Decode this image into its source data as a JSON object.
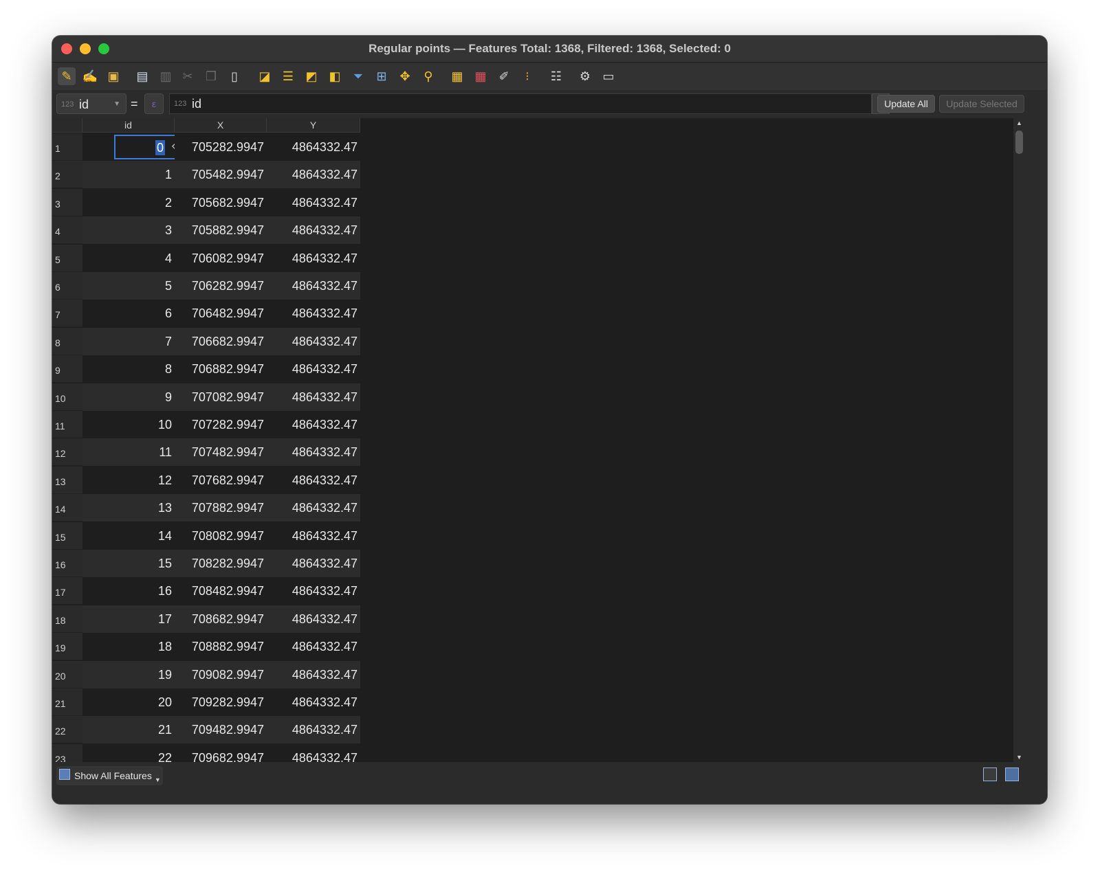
{
  "window": {
    "title": "Regular points — Features Total: 1368, Filtered: 1368, Selected: 0"
  },
  "toolbar": {
    "icons": [
      "toggle-editing-icon",
      "toggle-multi-edit-icon",
      "save-edits-icon",
      "reload-table-icon",
      "delete-selected-icon",
      "cut-selected-icon",
      "copy-selected-icon",
      "paste-features-icon",
      "select-by-expression-icon",
      "select-all-icon",
      "invert-selection-icon",
      "deselect-all-icon",
      "filter-selected-icon",
      "move-selection-to-top-icon",
      "pan-to-selected-icon",
      "zoom-to-selected-icon",
      "new-field-icon",
      "delete-field-icon",
      "field-calculator-icon",
      "conditional-formatting-icon",
      "dock-table-icon",
      "actions-icon",
      "organize-columns-icon"
    ]
  },
  "edit_bar": {
    "field_type_tag": "123",
    "field": "id",
    "equals": "=",
    "expression_type_tag": "123",
    "expression": "id",
    "update_all_label": "Update All",
    "update_selected_label": "Update Selected"
  },
  "table": {
    "columns": [
      "id",
      "X",
      "Y"
    ],
    "editing_value": "0",
    "rows": [
      {
        "n": "1",
        "id": "0",
        "x": "705282.9947",
        "y": "4864332.47"
      },
      {
        "n": "2",
        "id": "1",
        "x": "705482.9947",
        "y": "4864332.47"
      },
      {
        "n": "3",
        "id": "2",
        "x": "705682.9947",
        "y": "4864332.47"
      },
      {
        "n": "4",
        "id": "3",
        "x": "705882.9947",
        "y": "4864332.47"
      },
      {
        "n": "5",
        "id": "4",
        "x": "706082.9947",
        "y": "4864332.47"
      },
      {
        "n": "6",
        "id": "5",
        "x": "706282.9947",
        "y": "4864332.47"
      },
      {
        "n": "7",
        "id": "6",
        "x": "706482.9947",
        "y": "4864332.47"
      },
      {
        "n": "8",
        "id": "7",
        "x": "706682.9947",
        "y": "4864332.47"
      },
      {
        "n": "9",
        "id": "8",
        "x": "706882.9947",
        "y": "4864332.47"
      },
      {
        "n": "10",
        "id": "9",
        "x": "707082.9947",
        "y": "4864332.47"
      },
      {
        "n": "11",
        "id": "10",
        "x": "707282.9947",
        "y": "4864332.47"
      },
      {
        "n": "12",
        "id": "11",
        "x": "707482.9947",
        "y": "4864332.47"
      },
      {
        "n": "13",
        "id": "12",
        "x": "707682.9947",
        "y": "4864332.47"
      },
      {
        "n": "14",
        "id": "13",
        "x": "707882.9947",
        "y": "4864332.47"
      },
      {
        "n": "15",
        "id": "14",
        "x": "708082.9947",
        "y": "4864332.47"
      },
      {
        "n": "16",
        "id": "15",
        "x": "708282.9947",
        "y": "4864332.47"
      },
      {
        "n": "17",
        "id": "16",
        "x": "708482.9947",
        "y": "4864332.47"
      },
      {
        "n": "18",
        "id": "17",
        "x": "708682.9947",
        "y": "4864332.47"
      },
      {
        "n": "19",
        "id": "18",
        "x": "708882.9947",
        "y": "4864332.47"
      },
      {
        "n": "20",
        "id": "19",
        "x": "709082.9947",
        "y": "4864332.47"
      },
      {
        "n": "21",
        "id": "20",
        "x": "709282.9947",
        "y": "4864332.47"
      },
      {
        "n": "22",
        "id": "21",
        "x": "709482.9947",
        "y": "4864332.47"
      },
      {
        "n": "23",
        "id": "22",
        "x": "709682.9947",
        "y": "4864332.47"
      }
    ]
  },
  "bottom": {
    "show_all_label": "Show All Features"
  }
}
